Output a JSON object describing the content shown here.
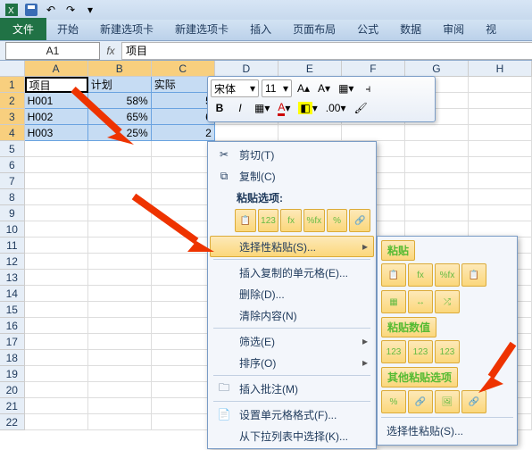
{
  "titlebar": {
    "app": "Excel"
  },
  "ribbon": {
    "file": "文件",
    "tabs": [
      "开始",
      "新建选项卡",
      "新建选项卡",
      "插入",
      "页面布局",
      "公式",
      "数据",
      "审阅",
      "视"
    ]
  },
  "namebox": "A1",
  "fx_label": "fx",
  "fx_value": "项目",
  "columns": [
    "A",
    "B",
    "C",
    "D",
    "E",
    "F",
    "G",
    "H"
  ],
  "rows": [
    "1",
    "2",
    "3",
    "4",
    "5",
    "6",
    "7",
    "8",
    "9",
    "10",
    "11",
    "12",
    "13",
    "14",
    "15",
    "16",
    "17",
    "18",
    "19",
    "20",
    "21",
    "22"
  ],
  "data": {
    "r1": {
      "A": "项目",
      "B": "计划",
      "C": "实际"
    },
    "r2": {
      "A": "H001",
      "B": "58%",
      "C": "5"
    },
    "r3": {
      "A": "H002",
      "B": "65%",
      "C": "6"
    },
    "r4": {
      "A": "H003",
      "B": "25%",
      "C": "2"
    }
  },
  "minitb": {
    "font": "宋体",
    "size": "11"
  },
  "ctx": {
    "cut": "剪切(T)",
    "copy": "复制(C)",
    "paste_opts_label": "粘贴选项:",
    "paste_special": "选择性粘贴(S)...",
    "insert_copied": "插入复制的单元格(E)...",
    "delete": "删除(D)...",
    "clear": "清除内容(N)",
    "filter": "筛选(E)",
    "sort": "排序(O)",
    "insert_comment": "插入批注(M)",
    "format_cells": "设置单元格格式(F)...",
    "pick_list": "从下拉列表中选择(K)...",
    "paste_icons": [
      "",
      "123",
      "fx",
      "%fx",
      "%",
      ""
    ]
  },
  "sub": {
    "paste_label": "粘贴",
    "paste_values_label": "粘贴数值",
    "other_label": "其他粘贴选项",
    "special_link": "选择性粘贴(S)...",
    "row1": [
      "",
      "fx",
      "%fx",
      ""
    ],
    "row2": [
      "",
      "",
      ""
    ],
    "vals": [
      "123",
      "123",
      "123"
    ],
    "other": [
      "%",
      "",
      "",
      ""
    ]
  }
}
